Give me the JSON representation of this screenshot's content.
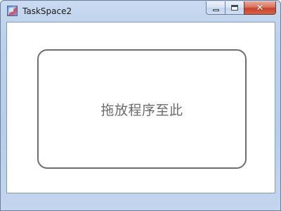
{
  "window": {
    "title": "TaskSpace2",
    "icon": "app-icon"
  },
  "caption_buttons": {
    "minimize_icon": "minimize-icon",
    "maximize_icon": "maximize-icon",
    "close_icon": "close-icon",
    "close_glyph": "✕"
  },
  "drop_zone": {
    "label": "拖放程序至此"
  },
  "colors": {
    "close_button": "#c7432a",
    "frame": "#bcd1ec",
    "drop_border": "#6e6e6e",
    "drop_text": "#6b6b6b"
  }
}
